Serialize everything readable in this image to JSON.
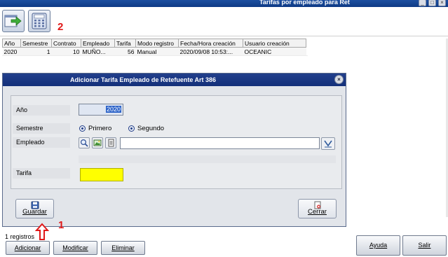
{
  "window": {
    "title": "Tarifas por empleado para Ret"
  },
  "annotations": {
    "toolbar_number": "2",
    "guardar_number": "1"
  },
  "grid": {
    "headers": [
      "Año",
      "Semestre",
      "Contrato",
      "Empleado",
      "Tarifa",
      "Modo registro",
      "Fecha/Hora creación",
      "Usuario creación"
    ],
    "rows": [
      [
        "2020",
        "1",
        "10",
        "MUÑO...",
        "56",
        "Manual",
        "2020/09/08 10:53:...",
        "OCEANIC"
      ]
    ]
  },
  "dialog": {
    "title": "Adicionar Tarifa Empleado de Retefuente Art 386",
    "labels": {
      "anio": "Año",
      "semestre": "Semestre",
      "empleado": "Empleado",
      "tarifa": "Tarifa"
    },
    "anio_value": "2020",
    "semestre_options": [
      "Primero",
      "Segundo"
    ],
    "semestre_selected": "Segundo",
    "empleado_value": "",
    "tarifa_value": "",
    "buttons": {
      "guardar": "Guardar",
      "cerrar": "Cerrar"
    }
  },
  "footer": {
    "status": "1 registros",
    "buttons": {
      "adicionar": "Adicionar",
      "modificar": "Modificar",
      "eliminar": "Eliminar",
      "ayuda": "Ayuda",
      "salir": "Salir"
    }
  },
  "colors": {
    "title_bar": "#1d4fa0",
    "tarifa_highlight": "#ffff00",
    "annotation": "#e01818"
  }
}
